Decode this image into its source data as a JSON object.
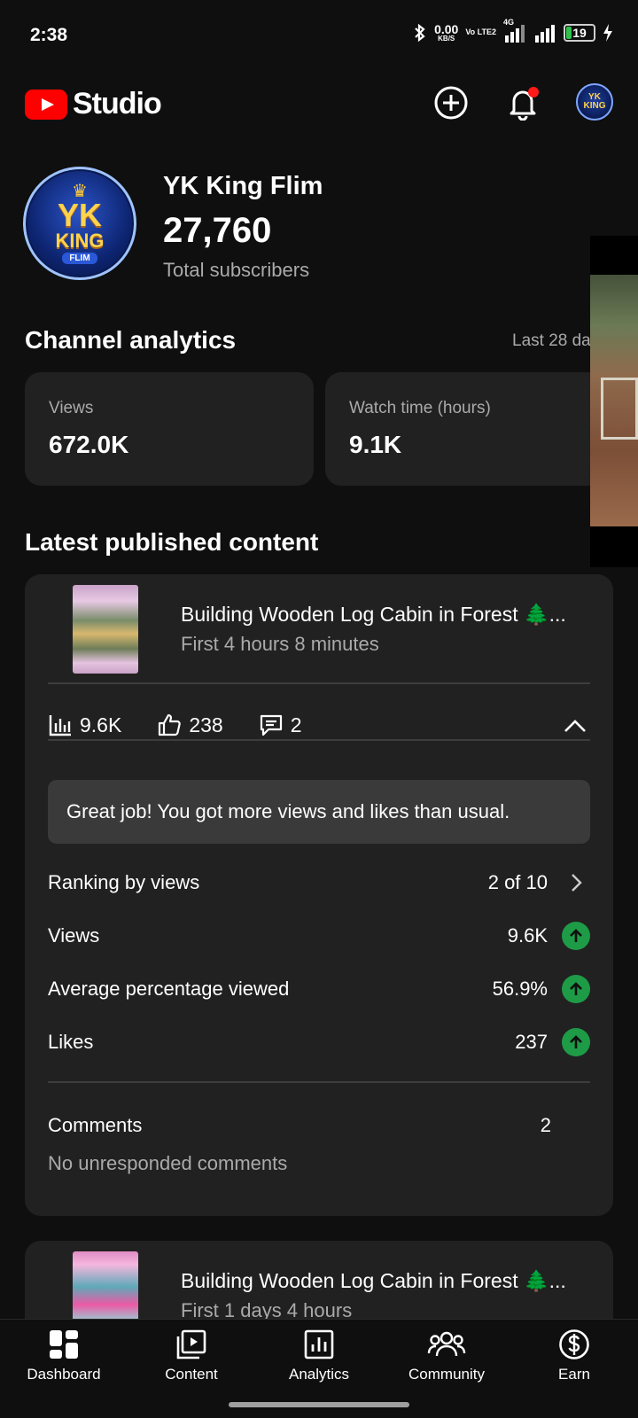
{
  "status_bar": {
    "time": "2:38",
    "net_speed": "0.00",
    "net_speed_unit": "KB/S",
    "volte": "Vo LTE2",
    "net_type": "4G",
    "battery": "19"
  },
  "header": {
    "logo_text": "Studio",
    "create_icon": "plus-circle-icon",
    "notifications_icon": "bell-icon",
    "avatar_text": "YK KING"
  },
  "channel": {
    "name": "YK King Flim",
    "subscriber_count": "27,760",
    "subscriber_label": "Total subscribers",
    "avatar_logo": {
      "crown": "♛",
      "line1": "YK",
      "line2": "KING",
      "line3": "FLIM"
    }
  },
  "analytics": {
    "title": "Channel analytics",
    "range": "Last 28 da",
    "cards": [
      {
        "label": "Views",
        "value": "672.0K"
      },
      {
        "label": "Watch time (hours)",
        "value": "9.1K"
      }
    ]
  },
  "latest": {
    "title": "Latest published content",
    "items": [
      {
        "title": "Building Wooden Log Cabin in Forest 🌲...",
        "subtitle": "First 4 hours 8 minutes",
        "views": "9.6K",
        "likes": "238",
        "comments": "2",
        "banner": "Great job! You got more views and likes than usual.",
        "ranking_label": "Ranking by views",
        "ranking_value": "2 of 10",
        "stats": [
          {
            "label": "Views",
            "value": "9.6K"
          },
          {
            "label": "Average percentage viewed",
            "value": "56.9%"
          },
          {
            "label": "Likes",
            "value": "237"
          }
        ],
        "comments_label": "Comments",
        "comments_value": "2",
        "comments_note": "No unresponded comments"
      },
      {
        "title": "Building Wooden Log Cabin in Forest 🌲...",
        "subtitle": "First 1 days 4 hours"
      }
    ]
  },
  "bottom_nav": [
    {
      "label": "Dashboard",
      "icon": "dashboard-icon"
    },
    {
      "label": "Content",
      "icon": "content-icon"
    },
    {
      "label": "Analytics",
      "icon": "analytics-icon"
    },
    {
      "label": "Community",
      "icon": "community-icon"
    },
    {
      "label": "Earn",
      "icon": "earn-icon"
    }
  ],
  "colors": {
    "background": "#0f0f0f",
    "card": "#212121",
    "brand_red": "#ff0000",
    "up_green": "#1e9b46",
    "battery_green": "#2fc24b"
  }
}
